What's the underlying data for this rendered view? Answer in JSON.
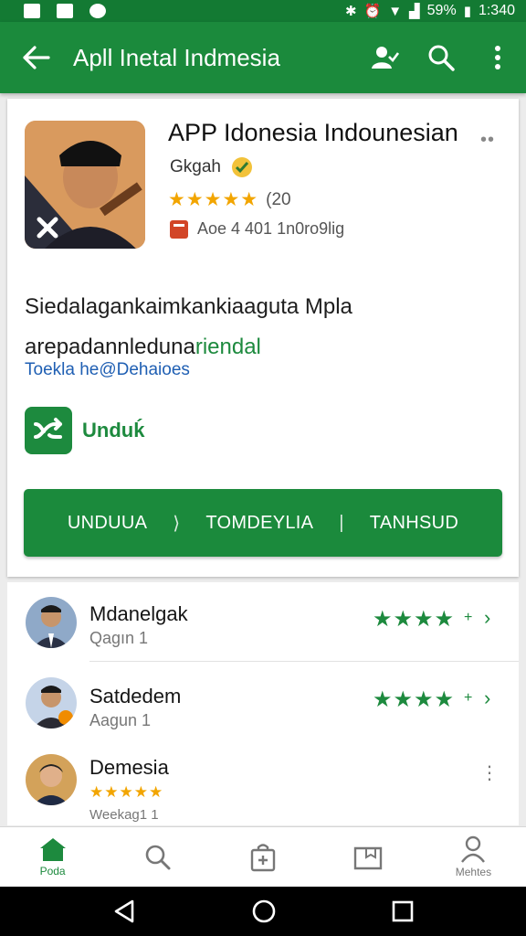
{
  "status_bar": {
    "battery": "59%",
    "time": "1:340"
  },
  "app_bar": {
    "title": "Apll Inetal Indmesia"
  },
  "app": {
    "name": "APP Idonesia Indounesian",
    "developer": "Gkgah",
    "rating_stars": 4.5,
    "rating_count": "(20",
    "age_text": "Aoe 4 401 1n0ro9lig",
    "description_line1": "Siedalagankaimkankiaaguta Mpla",
    "description_line2_a": "arepadannleduna",
    "description_line2_b": "riendal",
    "link": "Toekla he@Dehaioes",
    "download_label": "Unduḱ",
    "install_button": {
      "part1": "UNDUUA",
      "sep1": "⟩",
      "part2": "TOMDEYLIA",
      "sep2": "|",
      "part3": "TANHSUD"
    }
  },
  "reviews": [
    {
      "name": "Mdanelgak",
      "sub": "Qagın 1",
      "stars": "★★★★",
      "plus": "+"
    },
    {
      "name": "Satdedem",
      "sub": "Aagun 1",
      "stars": "★★★★",
      "plus": "+"
    },
    {
      "name": "Demesia",
      "sub": "Weekag1 1",
      "stars": "★★★★★"
    }
  ],
  "bottom_nav": {
    "items": [
      {
        "label": "Poda"
      },
      {
        "label": ""
      },
      {
        "label": ""
      },
      {
        "label": ""
      },
      {
        "label": "Mehtes"
      }
    ]
  },
  "colors": {
    "primary": "#1b8a3c",
    "status_bar": "#137a33",
    "star_gold": "#f2a500",
    "link_blue": "#1f5fb3"
  },
  "icons": {
    "app_bar": [
      "back-arrow-icon",
      "person-check-icon",
      "search-icon",
      "more-vert-icon"
    ],
    "bottom_nav": [
      "home-icon",
      "search-icon",
      "shopping-bag-icon",
      "folder-icon",
      "person-icon"
    ]
  }
}
